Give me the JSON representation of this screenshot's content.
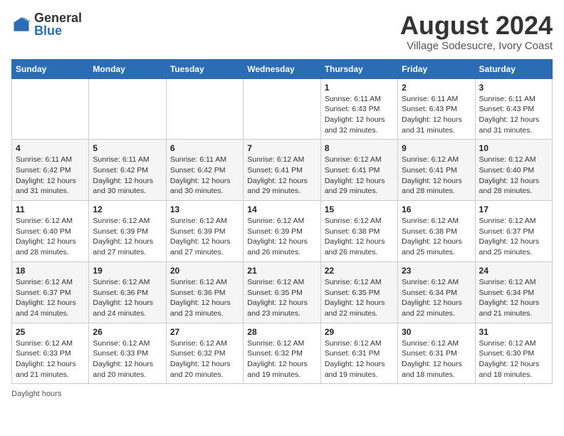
{
  "header": {
    "logo_general": "General",
    "logo_blue": "Blue",
    "main_title": "August 2024",
    "subtitle": "Village Sodesucre, Ivory Coast"
  },
  "footer": {
    "daylight_label": "Daylight hours"
  },
  "weekdays": [
    "Sunday",
    "Monday",
    "Tuesday",
    "Wednesday",
    "Thursday",
    "Friday",
    "Saturday"
  ],
  "weeks": [
    [
      {
        "day": "",
        "info": ""
      },
      {
        "day": "",
        "info": ""
      },
      {
        "day": "",
        "info": ""
      },
      {
        "day": "",
        "info": ""
      },
      {
        "day": "1",
        "info": "Sunrise: 6:11 AM\nSunset: 6:43 PM\nDaylight: 12 hours\nand 32 minutes."
      },
      {
        "day": "2",
        "info": "Sunrise: 6:11 AM\nSunset: 6:43 PM\nDaylight: 12 hours\nand 31 minutes."
      },
      {
        "day": "3",
        "info": "Sunrise: 6:11 AM\nSunset: 6:43 PM\nDaylight: 12 hours\nand 31 minutes."
      }
    ],
    [
      {
        "day": "4",
        "info": "Sunrise: 6:11 AM\nSunset: 6:42 PM\nDaylight: 12 hours\nand 31 minutes."
      },
      {
        "day": "5",
        "info": "Sunrise: 6:11 AM\nSunset: 6:42 PM\nDaylight: 12 hours\nand 30 minutes."
      },
      {
        "day": "6",
        "info": "Sunrise: 6:11 AM\nSunset: 6:42 PM\nDaylight: 12 hours\nand 30 minutes."
      },
      {
        "day": "7",
        "info": "Sunrise: 6:12 AM\nSunset: 6:41 PM\nDaylight: 12 hours\nand 29 minutes."
      },
      {
        "day": "8",
        "info": "Sunrise: 6:12 AM\nSunset: 6:41 PM\nDaylight: 12 hours\nand 29 minutes."
      },
      {
        "day": "9",
        "info": "Sunrise: 6:12 AM\nSunset: 6:41 PM\nDaylight: 12 hours\nand 28 minutes."
      },
      {
        "day": "10",
        "info": "Sunrise: 6:12 AM\nSunset: 6:40 PM\nDaylight: 12 hours\nand 28 minutes."
      }
    ],
    [
      {
        "day": "11",
        "info": "Sunrise: 6:12 AM\nSunset: 6:40 PM\nDaylight: 12 hours\nand 28 minutes."
      },
      {
        "day": "12",
        "info": "Sunrise: 6:12 AM\nSunset: 6:39 PM\nDaylight: 12 hours\nand 27 minutes."
      },
      {
        "day": "13",
        "info": "Sunrise: 6:12 AM\nSunset: 6:39 PM\nDaylight: 12 hours\nand 27 minutes."
      },
      {
        "day": "14",
        "info": "Sunrise: 6:12 AM\nSunset: 6:39 PM\nDaylight: 12 hours\nand 26 minutes."
      },
      {
        "day": "15",
        "info": "Sunrise: 6:12 AM\nSunset: 6:38 PM\nDaylight: 12 hours\nand 26 minutes."
      },
      {
        "day": "16",
        "info": "Sunrise: 6:12 AM\nSunset: 6:38 PM\nDaylight: 12 hours\nand 25 minutes."
      },
      {
        "day": "17",
        "info": "Sunrise: 6:12 AM\nSunset: 6:37 PM\nDaylight: 12 hours\nand 25 minutes."
      }
    ],
    [
      {
        "day": "18",
        "info": "Sunrise: 6:12 AM\nSunset: 6:37 PM\nDaylight: 12 hours\nand 24 minutes."
      },
      {
        "day": "19",
        "info": "Sunrise: 6:12 AM\nSunset: 6:36 PM\nDaylight: 12 hours\nand 24 minutes."
      },
      {
        "day": "20",
        "info": "Sunrise: 6:12 AM\nSunset: 6:36 PM\nDaylight: 12 hours\nand 23 minutes."
      },
      {
        "day": "21",
        "info": "Sunrise: 6:12 AM\nSunset: 6:35 PM\nDaylight: 12 hours\nand 23 minutes."
      },
      {
        "day": "22",
        "info": "Sunrise: 6:12 AM\nSunset: 6:35 PM\nDaylight: 12 hours\nand 22 minutes."
      },
      {
        "day": "23",
        "info": "Sunrise: 6:12 AM\nSunset: 6:34 PM\nDaylight: 12 hours\nand 22 minutes."
      },
      {
        "day": "24",
        "info": "Sunrise: 6:12 AM\nSunset: 6:34 PM\nDaylight: 12 hours\nand 21 minutes."
      }
    ],
    [
      {
        "day": "25",
        "info": "Sunrise: 6:12 AM\nSunset: 6:33 PM\nDaylight: 12 hours\nand 21 minutes."
      },
      {
        "day": "26",
        "info": "Sunrise: 6:12 AM\nSunset: 6:33 PM\nDaylight: 12 hours\nand 20 minutes."
      },
      {
        "day": "27",
        "info": "Sunrise: 6:12 AM\nSunset: 6:32 PM\nDaylight: 12 hours\nand 20 minutes."
      },
      {
        "day": "28",
        "info": "Sunrise: 6:12 AM\nSunset: 6:32 PM\nDaylight: 12 hours\nand 19 minutes."
      },
      {
        "day": "29",
        "info": "Sunrise: 6:12 AM\nSunset: 6:31 PM\nDaylight: 12 hours\nand 19 minutes."
      },
      {
        "day": "30",
        "info": "Sunrise: 6:12 AM\nSunset: 6:31 PM\nDaylight: 12 hours\nand 18 minutes."
      },
      {
        "day": "31",
        "info": "Sunrise: 6:12 AM\nSunset: 6:30 PM\nDaylight: 12 hours\nand 18 minutes."
      }
    ]
  ]
}
